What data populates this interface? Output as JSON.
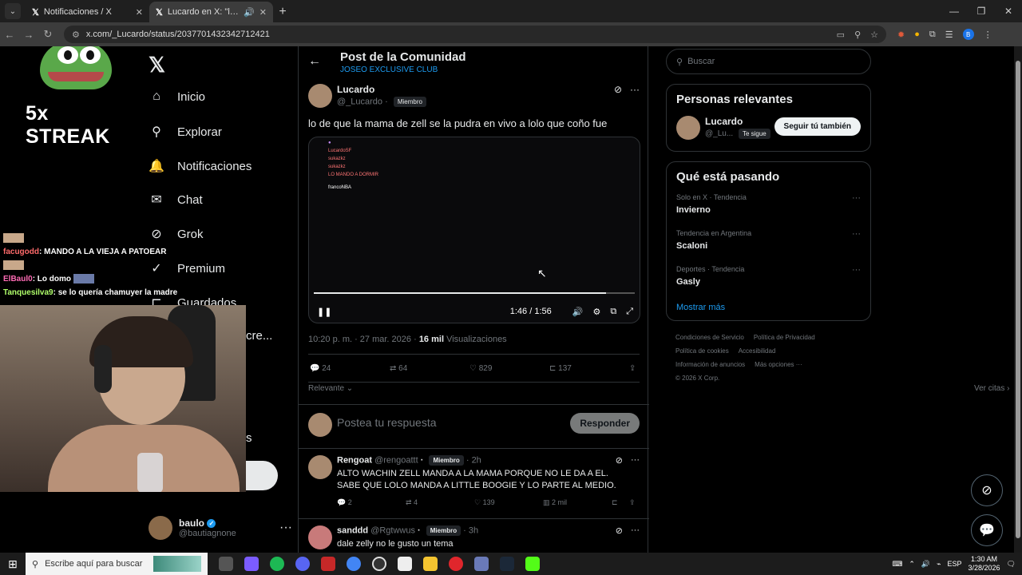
{
  "browser": {
    "tabs": [
      {
        "label": "Notificaciones / X"
      },
      {
        "label": "Lucardo en X: \"lo de que la"
      }
    ],
    "url": "x.com/_Lucardo/status/2037701432342712421"
  },
  "stream": {
    "logo_text": "5x STREAK",
    "chat": [
      {
        "user": "facugodd",
        "msg": ": MANDO A LA VIEJA A PATOEAR"
      },
      {
        "user": "ElBaul0",
        "msg": ": Lo domo"
      },
      {
        "user": "Tanquesilva9",
        "msg": ": se lo quería chamuyer la madre"
      }
    ]
  },
  "nav": {
    "items": [
      {
        "icon": "⌂",
        "label": "Inicio"
      },
      {
        "icon": "⚲",
        "label": "Explorar"
      },
      {
        "icon": "🔔",
        "label": "Notificaciones"
      },
      {
        "icon": "✉",
        "label": "Chat"
      },
      {
        "icon": "⊘",
        "label": "Grok"
      },
      {
        "icon": "✓",
        "label": "Premium"
      },
      {
        "icon": "⊏",
        "label": "Guardados"
      }
    ],
    "partial_1": "cre...",
    "partial_2": "s",
    "account": {
      "name": "baulo",
      "handle": "@bautiagnone",
      "more": "···"
    }
  },
  "header": {
    "title": "Post de la Comunidad",
    "subtitle": "JOSEO EXCLUSIVE CLUB"
  },
  "post": {
    "name": "Lucardo",
    "handle": "@_Lucardo",
    "badge": "Miembro",
    "text": "lo de que la mama de zell se la pudra en vivo a lolo que coño fue",
    "video": {
      "time": "1:46 / 1:56",
      "progress": 0.91,
      "chat": [
        "LucardoSF",
        "sukazkz",
        "sukazkz",
        "LO MANDO A DORMIR",
        "francoNBA"
      ]
    },
    "meta_time": "10:20 p. m. · 27 mar. 2026 ·",
    "views_count": "16 mil",
    "views_label": "Visualizaciones",
    "replies": "24",
    "reposts": "64",
    "likes": "829",
    "bookmarks": "137",
    "sort": "Relevante",
    "quotes": "Ver citas"
  },
  "reply_box": {
    "placeholder": "Postea tu respuesta",
    "button": "Responder"
  },
  "replies": [
    {
      "name": "Rengoat",
      "handle": "@rengoattt",
      "badge": "Miembro",
      "time": "· 2h",
      "text": "ALTO WACHIN ZELL MANDA A LA MAMA PORQUE NO LE DA A EL. SABE QUE LOLO MANDA A LITTLE BOOGIE Y LO PARTE AL MEDIO.",
      "replies": "2",
      "reposts": "4",
      "likes": "139",
      "views": "2 mil"
    },
    {
      "name": "sanddd",
      "handle": "@Rgtwwus",
      "badge": "Miembro",
      "time": "· 3h",
      "text": "dale zelly no le gusto un tema"
    }
  ],
  "sidebar": {
    "search_placeholder": "Buscar",
    "relevant": {
      "title": "Personas relevantes",
      "name": "Lucardo",
      "handle": "@_Lu...",
      "follows_you": "Te sigue",
      "follow_button": "Seguir tú también"
    },
    "trends": {
      "title": "Qué está pasando",
      "items": [
        {
          "context": "Solo en X · Tendencia",
          "name": "Invierno"
        },
        {
          "context": "Tendencia en Argentina",
          "name": "Scaloni"
        },
        {
          "context": "Deportes · Tendencia",
          "name": "Gasly"
        }
      ],
      "show_more": "Mostrar más"
    },
    "footer": [
      "Condiciones de Servicio",
      "Política de Privacidad",
      "Política de cookies",
      "Accesibilidad",
      "Información de anuncios",
      "Más opciones ···",
      "© 2026 X Corp."
    ]
  },
  "taskbar": {
    "search_placeholder": "Escribe aquí para buscar",
    "lang": "ESP",
    "time": "1:30 AM",
    "date": "3/28/2026"
  },
  "colors": {
    "accent": "#1d9bf0",
    "background": "#000000",
    "border": "#2f3336"
  }
}
